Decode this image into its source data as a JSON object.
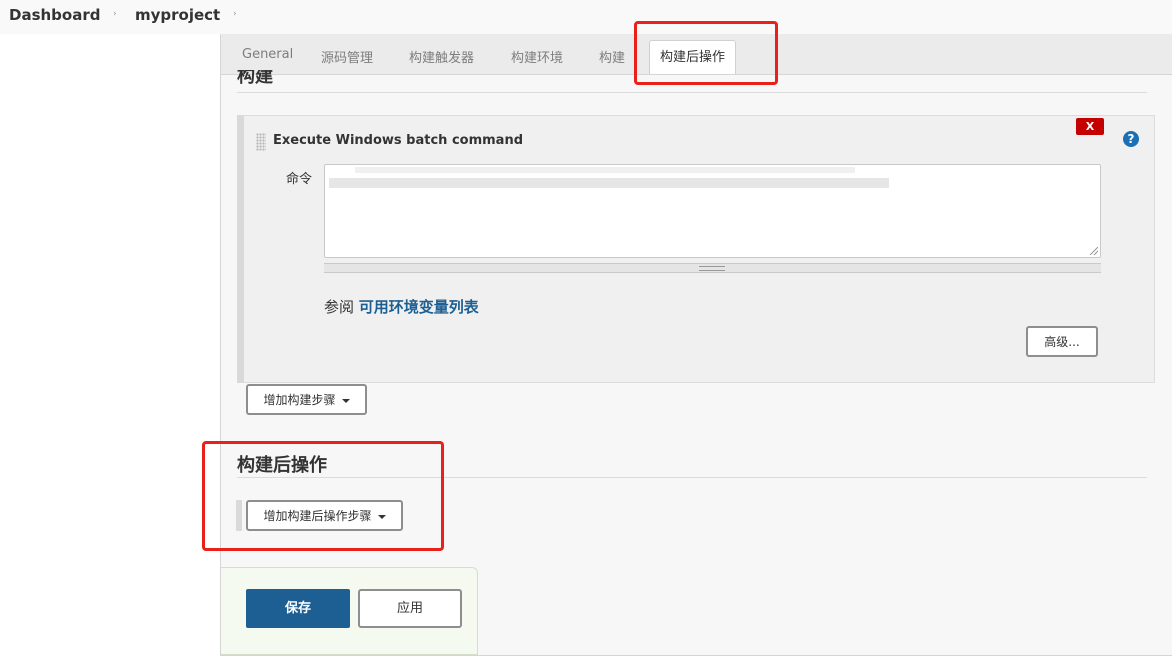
{
  "breadcrumb": {
    "items": [
      "Dashboard",
      "myproject"
    ],
    "separator": "›"
  },
  "tabs": [
    {
      "label": "General",
      "active": false
    },
    {
      "label": "源码管理",
      "active": false
    },
    {
      "label": "构建触发器",
      "active": false
    },
    {
      "label": "构建环境",
      "active": false
    },
    {
      "label": "构建",
      "active": false
    },
    {
      "label": "构建后操作",
      "active": true
    }
  ],
  "build_section": {
    "title": "构建",
    "step": {
      "title": "Execute Windows batch command",
      "delete_label": "X",
      "help_label": "?",
      "command_label": "命令",
      "command_value": "",
      "see_also_prefix": "参阅",
      "see_also_link": "可用环境变量列表",
      "advanced_label": "高级..."
    },
    "add_step_label": "增加构建步骤"
  },
  "post_build": {
    "title": "构建后操作",
    "add_label": "增加构建后操作步骤"
  },
  "actions": {
    "save_label": "保存",
    "apply_label": "应用"
  },
  "colors": {
    "primary_button": "#1d5f92",
    "delete_button": "#c40000",
    "link": "#1c5f93",
    "annotation_outline": "#e8221b"
  }
}
